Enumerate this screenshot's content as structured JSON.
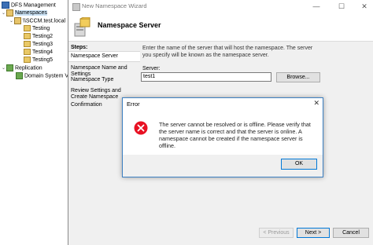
{
  "mmc": {
    "tree": [
      {
        "label": "DFS Management",
        "icon": "dfs-icon",
        "twisty": ""
      },
      {
        "label": "Namespaces",
        "icon": "namespace-folder-icon",
        "twisty": "⌄"
      },
      {
        "label": "\\\\SCCM.test.local",
        "icon": "namespace-icon",
        "twisty": "⌄"
      },
      {
        "label": "Testing",
        "icon": "folder-icon",
        "twisty": ""
      },
      {
        "label": "Testing2",
        "icon": "folder-icon",
        "twisty": ""
      },
      {
        "label": "Testing3",
        "icon": "folder-icon",
        "twisty": ""
      },
      {
        "label": "Testing4",
        "icon": "folder-icon",
        "twisty": ""
      },
      {
        "label": "Testing5",
        "icon": "folder-icon",
        "twisty": ""
      },
      {
        "label": "Replication",
        "icon": "replication-icon",
        "twisty": "⌄"
      },
      {
        "label": "Domain System V",
        "icon": "replication-group-icon",
        "twisty": ""
      }
    ]
  },
  "wizard": {
    "title": "New Namespace Wizard",
    "header_title": "Namespace Server",
    "steps_label": "Steps:",
    "steps": [
      "Namespace Server",
      "Namespace Name and Settings",
      "Namespace Type",
      "Review Settings and Create Namespace",
      "Confirmation"
    ],
    "active_step": "Namespace Server",
    "instruction": "Enter the name of the server that will host the namespace. The server you specify will be known as the namespace server.",
    "server_label": "Server:",
    "server_value": "test1",
    "browse_label": "Browse...",
    "previous_label": "< Previous",
    "next_label": "Next >",
    "cancel_label": "Cancel",
    "window_controls": {
      "minimize": "—",
      "maximize": "☐",
      "close": "✕"
    }
  },
  "error_dialog": {
    "title": "Error",
    "message": "The server cannot be resolved or is offline. Please verify that the server name is correct and that the server is online. A namespace cannot be created if the namespace server is offline.",
    "ok_label": "OK",
    "close_glyph": "✕",
    "icon": "error-icon",
    "icon_color": "#e81123"
  },
  "colors": {
    "selection": "#cce4f7",
    "dialog_border": "#3c7fc1",
    "default_button_border": "#0078d7"
  }
}
